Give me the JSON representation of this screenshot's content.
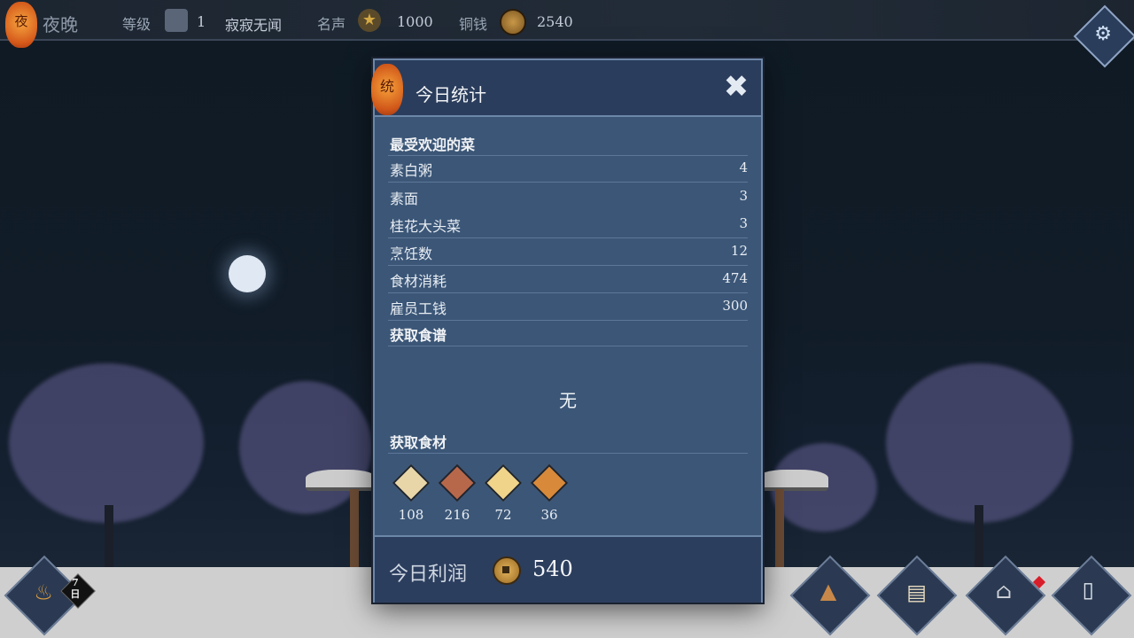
{
  "topbar": {
    "time_badge": "夜",
    "time_label": "夜晚",
    "level_label": "等级",
    "level_value": "1",
    "level_title": "寂寂无闻",
    "fame_label": "名声",
    "fame_value": "1000",
    "money_label": "铜钱",
    "money_value": "2540"
  },
  "icons": {
    "settings": "gear-icon"
  },
  "bottom": {
    "day_badge_num": "7",
    "day_badge_unit": "日"
  },
  "modal": {
    "badge": "统",
    "title": "今日统计",
    "close": "✖",
    "popular_title": "最受欢迎的菜",
    "popular_items": [
      {
        "name": "素白粥",
        "count": "4"
      },
      {
        "name": "素面",
        "count": "3"
      },
      {
        "name": "桂花大头菜",
        "count": "3"
      }
    ],
    "cooking_label": "烹饪数",
    "cooking_value": "12",
    "ingredient_cost_label": "食材消耗",
    "ingredient_cost_value": "474",
    "wages_label": "雇员工钱",
    "wages_value": "300",
    "recipes_title": "获取食谱",
    "recipes_none": "无",
    "ingredients_title": "获取食材",
    "ingredients": [
      {
        "icon": "rice-sack-icon",
        "count": "108",
        "color": "#e8d6a8"
      },
      {
        "icon": "bucket-icon",
        "count": "216",
        "color": "#b8684a"
      },
      {
        "icon": "noodles-icon",
        "count": "72",
        "color": "#f0d48a"
      },
      {
        "icon": "tofu-block-icon",
        "count": "36",
        "color": "#d88a3a"
      }
    ],
    "profit_label": "今日利润",
    "profit_value": "540"
  }
}
